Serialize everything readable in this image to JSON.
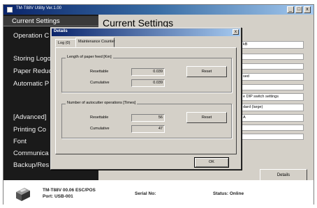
{
  "window": {
    "title": "TM-T88V Utility Ver.1.00",
    "min": "_",
    "max": "□",
    "close": "x"
  },
  "sidebar": {
    "items": [
      {
        "label": "Current Settings"
      },
      {
        "label": "Operation C"
      },
      {
        "label": "Storing Logo"
      },
      {
        "label": "Paper Reduc"
      },
      {
        "label": "Automatic P"
      },
      {
        "label": "[Advanced]"
      },
      {
        "label": "Printing Co"
      },
      {
        "label": "Font"
      },
      {
        "label": "Communica"
      },
      {
        "label": "Backup/Res"
      }
    ]
  },
  "content": {
    "title": "Current Settings",
    "lines": [
      "kB",
      "sed",
      "e DIP switch settings",
      "dard (large)",
      "A"
    ],
    "details_label": "Details"
  },
  "footer": {
    "model": "TM-T88V 00.06 ESC/POS",
    "port": "Port: USB-001",
    "serial": "Serial No:",
    "status": "Status: Online"
  },
  "dialog": {
    "title": "Details",
    "close": "x",
    "tabs": [
      {
        "label": "Log (0)"
      },
      {
        "label": "Maintenance Counter"
      }
    ],
    "paper_group": {
      "title": "Length of paper feed [Km]",
      "resettable_label": "Resettable",
      "resettable_value": "0.039",
      "cumulative_label": "Cumulative",
      "cumulative_value": "0.039",
      "reset_label": "Reset"
    },
    "cutter_group": {
      "title": "Number of autocutter operations [Times]",
      "resettable_label": "Resettable",
      "resettable_value": "56",
      "cumulative_label": "Cumulative",
      "cumulative_value": "47",
      "reset_label": "Reset"
    },
    "ok_label": "OK"
  }
}
